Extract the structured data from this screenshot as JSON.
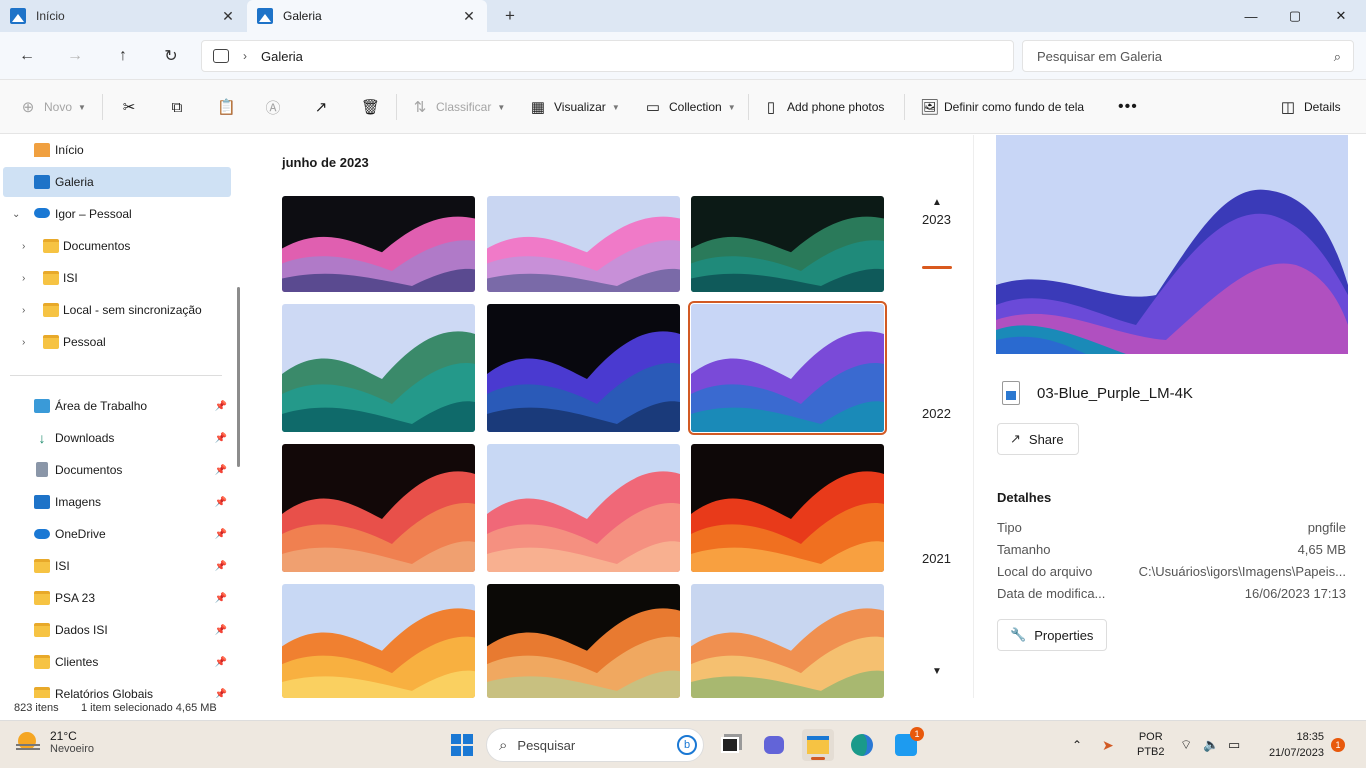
{
  "tabs": [
    {
      "label": "Início",
      "active": false
    },
    {
      "label": "Galeria",
      "active": true
    }
  ],
  "window_controls": {
    "minimize": "—",
    "maximize": "▢",
    "close": "✕",
    "new_tab": "+"
  },
  "address": {
    "crumb": "Galeria"
  },
  "search": {
    "placeholder": "Pesquisar em Galeria"
  },
  "commands": {
    "novo": "Novo",
    "classificar": "Classificar",
    "visualizar": "Visualizar",
    "collection": "Collection",
    "add_phone": "Add phone photos",
    "definir": "Definir como fundo de tela",
    "details": "Details"
  },
  "sidebar": {
    "items": [
      {
        "label": "Início",
        "icon": "home-icon"
      },
      {
        "label": "Galeria",
        "icon": "gallery-icon",
        "selected": true
      },
      {
        "label": "Igor – Pessoal",
        "icon": "onedrive-icon",
        "expanded": true
      },
      {
        "label": "Documentos",
        "icon": "folder-icon"
      },
      {
        "label": "ISI",
        "icon": "folder-icon"
      },
      {
        "label": "Local - sem sincronização",
        "icon": "folder-icon"
      },
      {
        "label": "Pessoal",
        "icon": "folder-icon"
      }
    ],
    "quick_access": [
      {
        "label": "Área de Trabalho",
        "icon": "desktop-icon"
      },
      {
        "label": "Downloads",
        "icon": "download-icon"
      },
      {
        "label": "Documentos",
        "icon": "document-icon"
      },
      {
        "label": "Imagens",
        "icon": "pictures-icon"
      },
      {
        "label": "OneDrive",
        "icon": "onedrive-icon"
      },
      {
        "label": "ISI",
        "icon": "folder-icon"
      },
      {
        "label": "PSA 23",
        "icon": "folder-icon"
      },
      {
        "label": "Dados ISI",
        "icon": "folder-icon"
      },
      {
        "label": "Clientes",
        "icon": "folder-icon"
      },
      {
        "label": "Relatórios Globais",
        "icon": "folder-icon"
      }
    ]
  },
  "gallery": {
    "month": "junho de 2023",
    "thumbs": [
      {
        "bg": "#0d0d12",
        "c1": "#e05fb0",
        "c2": "#b07ac8",
        "c3": "#5a4a90"
      },
      {
        "bg": "#c9d6f2",
        "c1": "#f07ac8",
        "c2": "#c890d8",
        "c3": "#7a6aa8"
      },
      {
        "bg": "#0c1a16",
        "c1": "#2a7a5a",
        "c2": "#1f8a7a",
        "c3": "#0f5a5a"
      },
      {
        "bg": "#cdd9f4",
        "c1": "#3a8a6a",
        "c2": "#24998a",
        "c3": "#0f6a6a"
      },
      {
        "bg": "#08080e",
        "c1": "#4a3ad0",
        "c2": "#2a5ab8",
        "c3": "#1a3a7a"
      },
      {
        "bg": "#c8d6f6",
        "c1": "#7a4ad8",
        "c2": "#3a6ad0",
        "c3": "#1a8ab8"
      },
      {
        "bg": "#120808",
        "c1": "#e8504a",
        "c2": "#f08050",
        "c3": "#f0a070"
      },
      {
        "bg": "#c8d8f4",
        "c1": "#f06878",
        "c2": "#f59080",
        "c3": "#f8b090"
      },
      {
        "bg": "#0e0808",
        "c1": "#e83a1a",
        "c2": "#f07020",
        "c3": "#f8a040"
      },
      {
        "bg": "#c8d8f4",
        "c1": "#f08030",
        "c2": "#f8b040",
        "c3": "#fad060"
      },
      {
        "bg": "#0b0906",
        "c1": "#e87a30",
        "c2": "#f0a860",
        "c3": "#c8c080"
      },
      {
        "bg": "#c8d6f0",
        "c1": "#f09050",
        "c2": "#f5c070",
        "c3": "#a8b870"
      }
    ],
    "selected_index": 5
  },
  "timeline": {
    "years": [
      "2023",
      "2022",
      "2021"
    ],
    "up": "▲",
    "down": "▼"
  },
  "details": {
    "filename": "03-Blue_Purple_LM-4K",
    "share": "Share",
    "heading": "Detalhes",
    "rows": [
      {
        "key": "Tipo",
        "value": "pngfile"
      },
      {
        "key": "Tamanho",
        "value": "4,65 MB"
      },
      {
        "key": "Local do arquivo",
        "value": "C:\\Usuários\\igors\\Imagens\\Papeis..."
      },
      {
        "key": "Data de modifica...",
        "value": "16/06/2023 17:13"
      }
    ],
    "properties": "Properties"
  },
  "status": {
    "count": "823 itens",
    "selection": "1 item selecionado  4,65 MB"
  },
  "taskbar": {
    "temp": "21°C",
    "weather": "Nevoeiro",
    "search": "Pesquisar",
    "lang1": "POR",
    "lang2": "PTB2",
    "time": "18:35",
    "date": "21/07/2023",
    "twitter_badge": "1",
    "notif_badge": "1"
  }
}
